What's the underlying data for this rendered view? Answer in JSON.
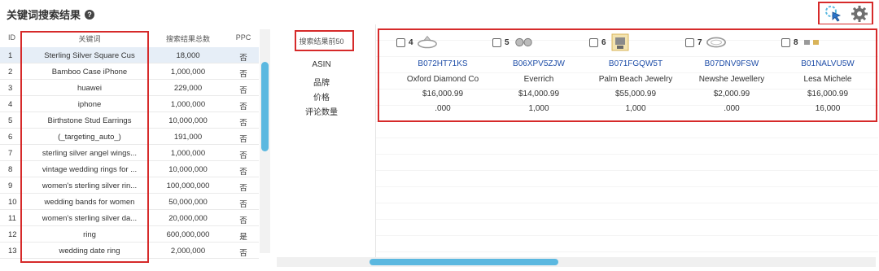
{
  "title": "关键词搜索结果",
  "help_icon": "?",
  "tools": {
    "cursor_icon": "pointer-click-icon",
    "settings_icon": "gear-icon"
  },
  "left_table": {
    "headers": {
      "id": "ID",
      "keyword": "关键词",
      "count": "搜索结果总数",
      "ppc": "PPC"
    },
    "rows": [
      {
        "id": "1",
        "keyword": "Sterling Silver Square Cus",
        "count": "18,000",
        "ppc": "否"
      },
      {
        "id": "2",
        "keyword": "Bamboo Case iPhone",
        "count": "1,000,000",
        "ppc": "否"
      },
      {
        "id": "3",
        "keyword": "huawei",
        "count": "229,000",
        "ppc": "否"
      },
      {
        "id": "4",
        "keyword": "iphone",
        "count": "1,000,000",
        "ppc": "否"
      },
      {
        "id": "5",
        "keyword": "Birthstone Stud Earrings",
        "count": "10,000,000",
        "ppc": "否"
      },
      {
        "id": "6",
        "keyword": "(_targeting_auto_)",
        "count": "191,000",
        "ppc": "否"
      },
      {
        "id": "7",
        "keyword": "sterling silver angel wings...",
        "count": "1,000,000",
        "ppc": "否"
      },
      {
        "id": "8",
        "keyword": "vintage wedding rings for ...",
        "count": "10,000,000",
        "ppc": "否"
      },
      {
        "id": "9",
        "keyword": "women's sterling silver rin...",
        "count": "100,000,000",
        "ppc": "否"
      },
      {
        "id": "10",
        "keyword": "wedding bands for women",
        "count": "50,000,000",
        "ppc": "否"
      },
      {
        "id": "11",
        "keyword": "women's sterling silver da...",
        "count": "20,000,000",
        "ppc": "否"
      },
      {
        "id": "12",
        "keyword": "ring",
        "count": "600,000,000",
        "ppc": "是"
      },
      {
        "id": "13",
        "keyword": "wedding date ring",
        "count": "2,000,000",
        "ppc": "否"
      }
    ]
  },
  "right_panel": {
    "row_labels": [
      "搜索结果前50",
      "ASIN",
      "品牌",
      "价格",
      "评论数量"
    ],
    "products": [
      {
        "rank": "4",
        "asin": "B072HT71KS",
        "brand": "Oxford Diamond Co",
        "price": "$16,000.99",
        "reviews": ".000"
      },
      {
        "rank": "5",
        "asin": "B06XPV5ZJW",
        "brand": "Everrich",
        "price": "$14,000.99",
        "reviews": "1,000"
      },
      {
        "rank": "6",
        "asin": "B071FGQW5T",
        "brand": "Palm Beach Jewelry",
        "price": "$55,000.99",
        "reviews": "1,000"
      },
      {
        "rank": "7",
        "asin": "B07DNV9FSW",
        "brand": "Newshe Jewellery",
        "price": "$2,000.99",
        "reviews": ".000"
      },
      {
        "rank": "8",
        "asin": "B01NALVU5W",
        "brand": "Lesa Michele",
        "price": "$16,000.99",
        "reviews": "16,000"
      }
    ]
  },
  "colors": {
    "accent": "#5bb8e0",
    "highlight": "#d62a2a",
    "link": "#1f4ea8",
    "selected_row": "#e6eef7"
  }
}
